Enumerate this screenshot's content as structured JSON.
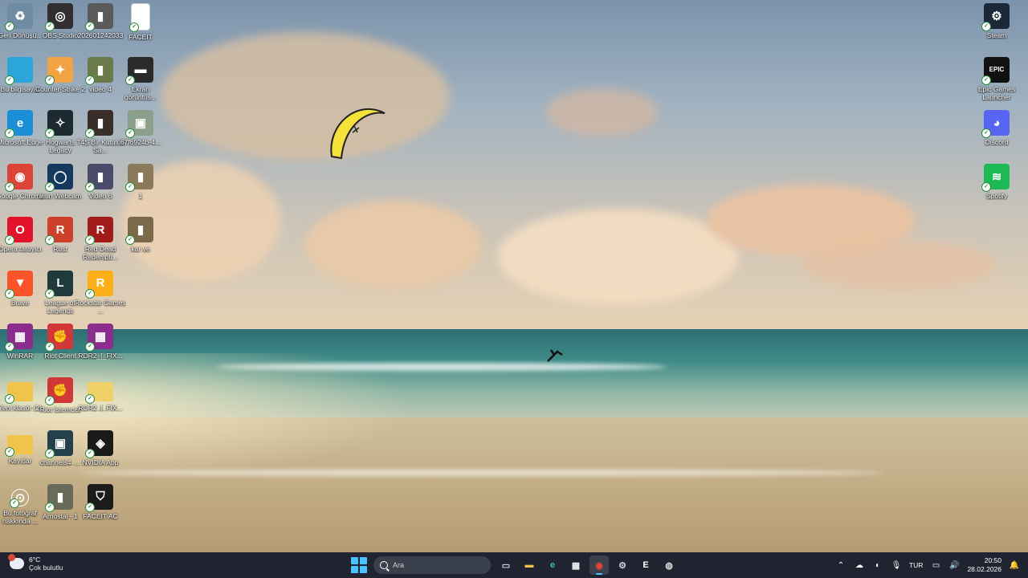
{
  "desktop_icons": [
    {
      "id": "recycle",
      "label": "Geri Dönüşü...",
      "icon": "recycle-bin-icon",
      "bg": "#6f8aa3",
      "glyph": "♻"
    },
    {
      "id": "this-pc",
      "label": "Bu bilgisayar",
      "icon": "computer-icon",
      "bg": "#2aa6d8",
      "glyph": ""
    },
    {
      "id": "edge",
      "label": "Microsoft Edge",
      "icon": "edge-icon",
      "bg": "#1a8fd6",
      "glyph": "e"
    },
    {
      "id": "chrome",
      "label": "Google Chrome",
      "icon": "chrome-icon",
      "bg": "#db4437",
      "glyph": "◉"
    },
    {
      "id": "opera",
      "label": "Opera tarayıcı",
      "icon": "opera-icon",
      "bg": "#e3132c",
      "glyph": "O"
    },
    {
      "id": "brave",
      "label": "Brave",
      "icon": "brave-icon",
      "bg": "#fb542b",
      "glyph": "▼"
    },
    {
      "id": "winrar",
      "label": "WinRAR",
      "icon": "winrar-icon",
      "bg": "#8b2c8e",
      "glyph": "▦"
    },
    {
      "id": "yeni-klasor",
      "label": "Yeni klasör (2)",
      "icon": "folder-icon",
      "bg": "#f0c44a",
      "glyph": ""
    },
    {
      "id": "kayitlar",
      "label": "Kayıtlar",
      "icon": "folder-icon",
      "bg": "#f0c44a",
      "glyph": ""
    },
    {
      "id": "bu-fotograf",
      "label": "Bu fotoğraf hakkında ...",
      "icon": "camera-info-icon",
      "bg": "transparent",
      "glyph": "⊙"
    },
    {
      "id": "obs",
      "label": "OBS Studio",
      "icon": "obs-icon",
      "bg": "#302e31",
      "glyph": "◎"
    },
    {
      "id": "cs2",
      "label": "Counter-Strike 2",
      "icon": "counter-strike-icon",
      "bg": "#f2a444",
      "glyph": "✦"
    },
    {
      "id": "hogwarts",
      "label": "Hogwarts Legacy",
      "icon": "hogwarts-icon",
      "bg": "#1d2a30",
      "glyph": "✧"
    },
    {
      "id": "iriun",
      "label": "Iriun Webcam",
      "icon": "webcam-icon",
      "bg": "#15395e",
      "glyph": "◯"
    },
    {
      "id": "rust",
      "label": "Rust",
      "icon": "rust-icon",
      "bg": "#cd412b",
      "glyph": "R"
    },
    {
      "id": "lol",
      "label": "League of Legends",
      "icon": "league-icon",
      "bg": "#1e3a3a",
      "glyph": "L"
    },
    {
      "id": "riot-client",
      "label": "Riot Client",
      "icon": "riot-icon",
      "bg": "#d13639",
      "glyph": "✊"
    },
    {
      "id": "riot-istemci",
      "label": "Riot İstemcisi",
      "icon": "riot-icon",
      "bg": "#d13639",
      "glyph": "✊"
    },
    {
      "id": "channel",
      "label": "channels4_...",
      "icon": "image-icon",
      "bg": "#24404a",
      "glyph": "▣"
    },
    {
      "id": "arnostal",
      "label": "Arnostal - 1",
      "icon": "video-file-icon",
      "bg": "#6a6a5a",
      "glyph": "▮"
    },
    {
      "id": "img2026",
      "label": "202601242033",
      "icon": "video-file-icon",
      "bg": "#5a5a5a",
      "glyph": "▮"
    },
    {
      "id": "video4",
      "label": "video 4",
      "icon": "video-file-icon",
      "bg": "#6b7a4a",
      "glyph": "▮"
    },
    {
      "id": "t4s",
      "label": "T4S Bir Kutuluk Sa...",
      "icon": "video-file-icon",
      "bg": "#3a2e2a",
      "glyph": "▮"
    },
    {
      "id": "video6",
      "label": "Video 6",
      "icon": "video-file-icon",
      "bg": "#4a4a6a",
      "glyph": "▮"
    },
    {
      "id": "rdr2",
      "label": "Red Dead Redempti...",
      "icon": "red-dead-icon",
      "bg": "#a21b1b",
      "glyph": "R"
    },
    {
      "id": "rockstar",
      "label": "Rockstar Games ...",
      "icon": "rockstar-icon",
      "bg": "#fcaf17",
      "glyph": "R"
    },
    {
      "id": "rdr2-zip",
      "label": "RDR2_[_FIX...",
      "icon": "winrar-icon",
      "bg": "#8b2c8e",
      "glyph": "▦"
    },
    {
      "id": "rdr2-folder",
      "label": "RDR2_[_FIX...",
      "icon": "folder-icon",
      "bg": "#f0d068",
      "glyph": ""
    },
    {
      "id": "nvidia",
      "label": "NVIDIA App",
      "icon": "nvidia-icon",
      "bg": "#1a1a1a",
      "glyph": "◈"
    },
    {
      "id": "faceit-ac",
      "label": "FACEIT AC",
      "icon": "faceit-ac-icon",
      "bg": "#1b1b1b",
      "glyph": "⛉"
    },
    {
      "id": "faceit",
      "label": "FACEIT",
      "icon": "blank-file-icon",
      "bg": "#ffffff",
      "glyph": ""
    },
    {
      "id": "ekran",
      "label": "Ekran görüntüs...",
      "icon": "screenshot-icon",
      "bg": "#2a2a2a",
      "glyph": "▬"
    },
    {
      "id": "img6776",
      "label": "67f6924b-4...",
      "icon": "image-icon",
      "bg": "#8aa08a",
      "glyph": "▣"
    },
    {
      "id": "one",
      "label": "1",
      "icon": "video-file-icon",
      "bg": "#8a7a5a",
      "glyph": "▮"
    },
    {
      "id": "karye",
      "label": "kar ye",
      "icon": "video-file-icon",
      "bg": "#7a6a4a",
      "glyph": "▮"
    },
    {
      "id": "steam",
      "label": "Steam",
      "icon": "steam-icon",
      "bg": "#1b2838",
      "glyph": "⚙"
    },
    {
      "id": "epic",
      "label": "Epic Games Launcher",
      "icon": "epic-icon",
      "bg": "#111111",
      "glyph": "EPIC"
    },
    {
      "id": "discord",
      "label": "Discord",
      "icon": "discord-icon",
      "bg": "#5865f2",
      "glyph": "◕"
    },
    {
      "id": "spotify",
      "label": "Spotify",
      "icon": "spotify-icon",
      "bg": "#1db954",
      "glyph": "≋"
    }
  ],
  "taskbar": {
    "weather": {
      "temp": "6°C",
      "condition": "Çok bulutlu",
      "icon": "cloud-icon"
    },
    "search_placeholder": "Ara",
    "apps": [
      {
        "id": "task-view",
        "icon": "task-view-icon",
        "glyph": "▭",
        "color": "#cfd3da"
      },
      {
        "id": "explorer",
        "icon": "folder-icon",
        "glyph": "▬",
        "color": "#f0c44a"
      },
      {
        "id": "edge",
        "icon": "edge-icon",
        "glyph": "e",
        "color": "#2ec4b6"
      },
      {
        "id": "store",
        "icon": "store-icon",
        "glyph": "▦",
        "color": "#f3f3f3"
      },
      {
        "id": "chrome",
        "icon": "chrome-icon",
        "glyph": "◉",
        "color": "#ea4335",
        "active": true
      },
      {
        "id": "steam",
        "icon": "steam-icon",
        "glyph": "⚙",
        "color": "#c7d5e0"
      },
      {
        "id": "epic",
        "icon": "epic-icon",
        "glyph": "E",
        "color": "#ffffff"
      },
      {
        "id": "overlay",
        "icon": "app-icon",
        "glyph": "◍",
        "color": "#d9d9d9"
      }
    ],
    "tray": {
      "language": "TUR",
      "time": "20:50",
      "date": "28.02.2026"
    }
  },
  "colors": {
    "taskbar_bg": "#1f2430",
    "accent": "#4cc2ff"
  }
}
